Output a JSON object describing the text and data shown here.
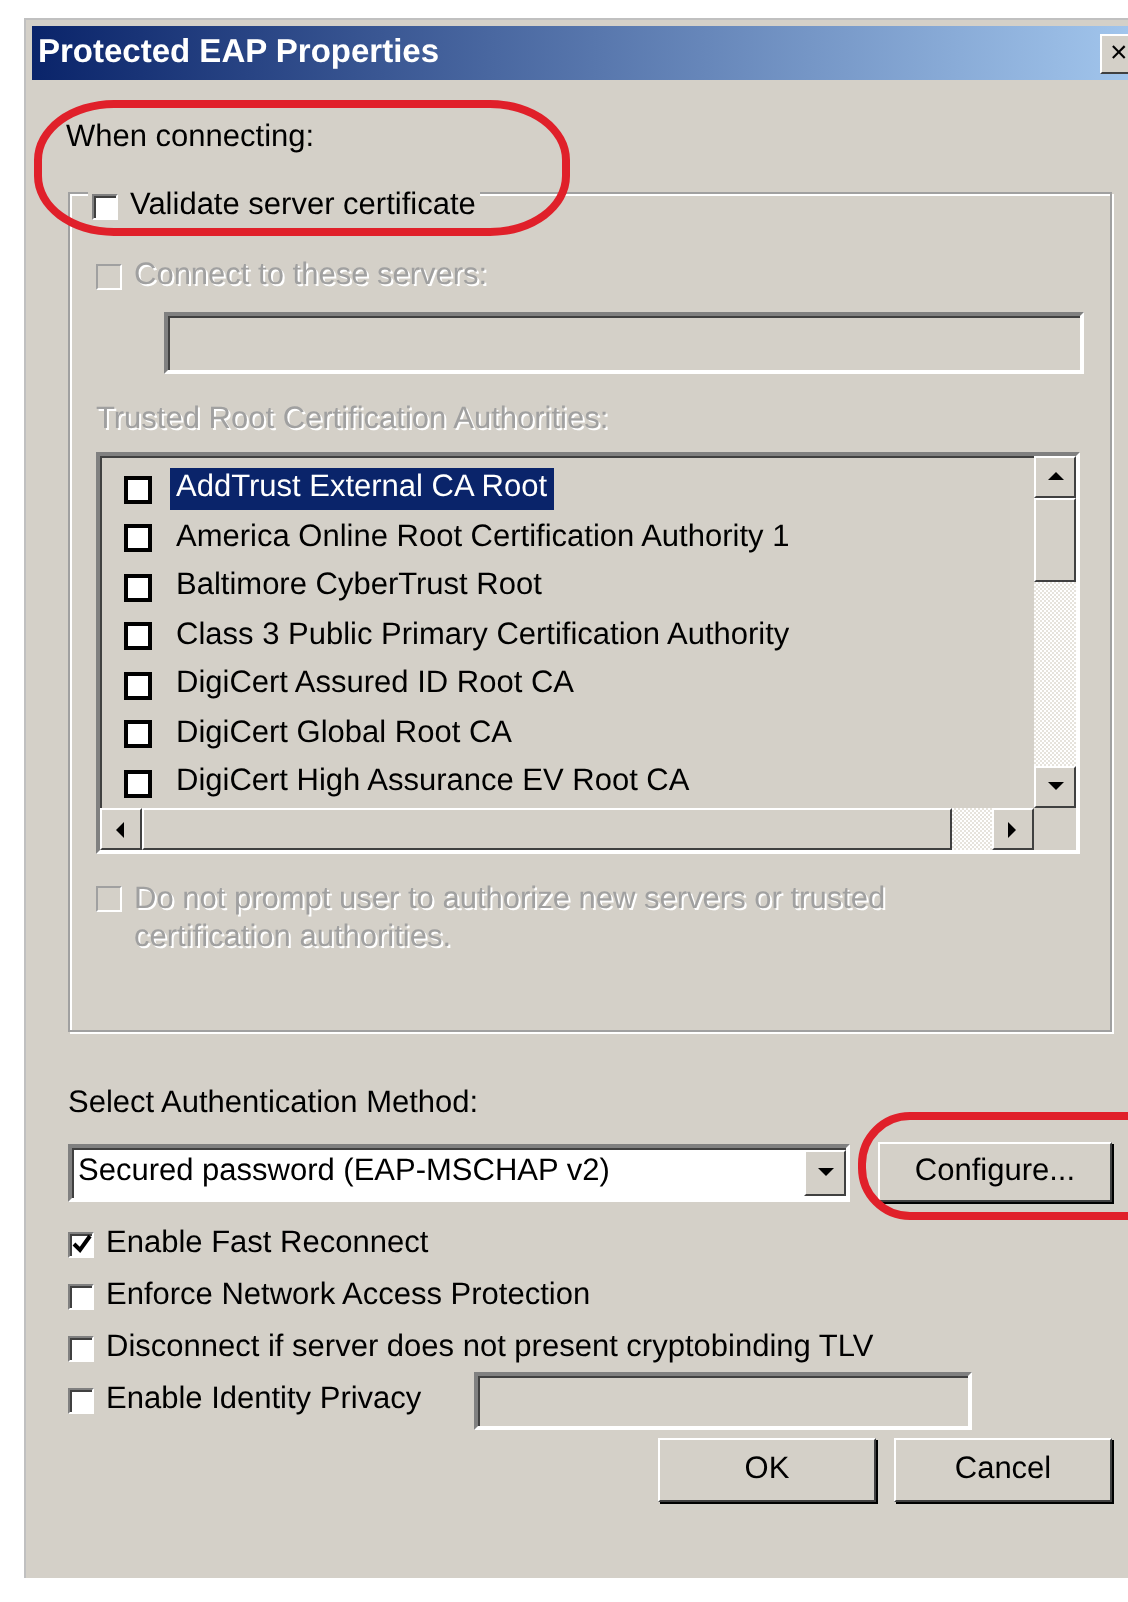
{
  "window": {
    "title": "Protected EAP Properties",
    "close": "×"
  },
  "when_connecting_label": "When connecting:",
  "validate_server_certificate": {
    "label": "Validate server certificate",
    "checked": false
  },
  "connect_to_servers": {
    "label": "Connect to these servers:",
    "checked": false,
    "disabled": true
  },
  "servers_field": {
    "disabled": true
  },
  "trusted_root_label": {
    "text": "Trusted Root Certification Authorities:",
    "disabled": true
  },
  "authorities": [
    {
      "label": "AddTrust External CA Root",
      "checked": false,
      "selected": true
    },
    {
      "label": "America Online Root Certification Authority 1",
      "checked": false,
      "selected": false
    },
    {
      "label": "Baltimore CyberTrust Root",
      "checked": false,
      "selected": false
    },
    {
      "label": "Class 3 Public Primary Certification Authority",
      "checked": false,
      "selected": false
    },
    {
      "label": "DigiCert Assured ID Root CA",
      "checked": false,
      "selected": false
    },
    {
      "label": "DigiCert Global Root CA",
      "checked": false,
      "selected": false
    },
    {
      "label": "DigiCert High Assurance EV Root CA",
      "checked": false,
      "selected": false
    }
  ],
  "do_not_prompt": {
    "label": "Do not prompt user to authorize new servers or trusted certification authorities.",
    "checked": false,
    "disabled": true
  },
  "auth_method_label": "Select Authentication Method:",
  "auth_method": {
    "value": "Secured password (EAP-MSCHAP v2)"
  },
  "configure_button": "Configure...",
  "options": [
    {
      "label": "Enable Fast Reconnect",
      "checked": true
    },
    {
      "label": "Enforce Network Access Protection",
      "checked": false
    },
    {
      "label": "Disconnect if server does not present cryptobinding TLV",
      "checked": false
    },
    {
      "label": "Enable Identity Privacy",
      "checked": false
    }
  ],
  "buttons": [
    "OK",
    "Cancel"
  ]
}
